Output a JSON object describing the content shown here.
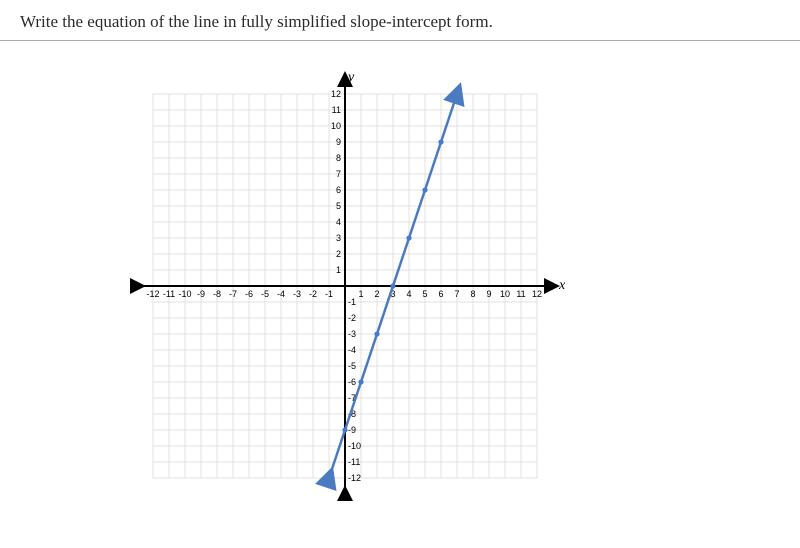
{
  "prompt": "Write the equation of the line in fully simplified slope-intercept form.",
  "axis": {
    "x_label": "x",
    "y_label": "y"
  },
  "ticks": {
    "x": [
      "-12",
      "-11",
      "-10",
      "-9",
      "-8",
      "-7",
      "-6",
      "-5",
      "-4",
      "-3",
      "-2",
      "-1",
      "1",
      "2",
      "3",
      "4",
      "5",
      "6",
      "7",
      "8",
      "9",
      "10",
      "11",
      "12"
    ],
    "y_pos": [
      "1",
      "2",
      "3",
      "4",
      "5",
      "6",
      "7",
      "8",
      "9",
      "10",
      "11",
      "12"
    ],
    "y_neg": [
      "-1",
      "-2",
      "-3",
      "-4",
      "-5",
      "-6",
      "-7",
      "-8",
      "-9",
      "-10",
      "-11",
      "-12"
    ]
  },
  "chart_data": {
    "type": "line",
    "title": "",
    "xlabel": "x",
    "ylabel": "y",
    "xlim": [
      -12,
      12
    ],
    "ylim": [
      -12,
      12
    ],
    "grid": true,
    "series": [
      {
        "name": "line",
        "color": "#4a7bc0",
        "points": [
          {
            "x": -1,
            "y": -12
          },
          {
            "x": 0,
            "y": -9
          },
          {
            "x": 1,
            "y": -6
          },
          {
            "x": 2,
            "y": -3
          },
          {
            "x": 3,
            "y": 0
          },
          {
            "x": 4,
            "y": 3
          },
          {
            "x": 5,
            "y": 6
          },
          {
            "x": 6,
            "y": 9
          },
          {
            "x": 7,
            "y": 12
          }
        ],
        "slope": 3,
        "y_intercept": -9,
        "equation": "y = 3x - 9"
      }
    ]
  }
}
